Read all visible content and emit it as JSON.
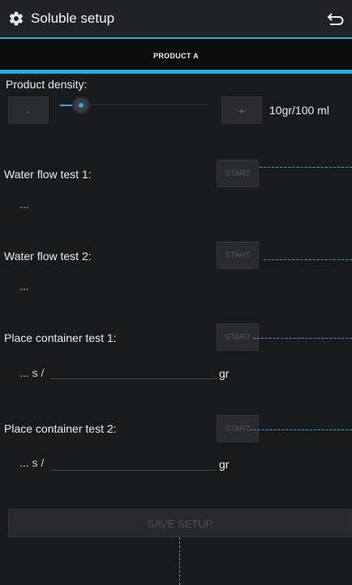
{
  "action_bar": {
    "title": "Soluble setup",
    "app_icon": "gear-icon",
    "back_icon": "return-arrow-icon"
  },
  "tab": {
    "label": "PRODUCT A"
  },
  "density": {
    "label": "Product density:",
    "minus_label": "-",
    "plus_label": "+",
    "value_text": "10gr/100 ml",
    "slider_level_percent": 12
  },
  "tests": {
    "water1": {
      "label": "Water flow test 1:",
      "button": "START",
      "result": "..."
    },
    "water2": {
      "label": "Water flow test 2:",
      "button": "START",
      "result": "..."
    },
    "container1": {
      "label": "Place container test 1:",
      "button": "START",
      "time": "... s /",
      "unit": "gr",
      "weight_value": ""
    },
    "container2": {
      "label": "Place container test 2:",
      "button": "START",
      "time": "... s /",
      "unit": "gr",
      "weight_value": ""
    }
  },
  "save_button": "SAVE SETUP",
  "colors": {
    "accent": "#27a9e1",
    "background": "#191a1c",
    "action_bar": "#212226"
  }
}
